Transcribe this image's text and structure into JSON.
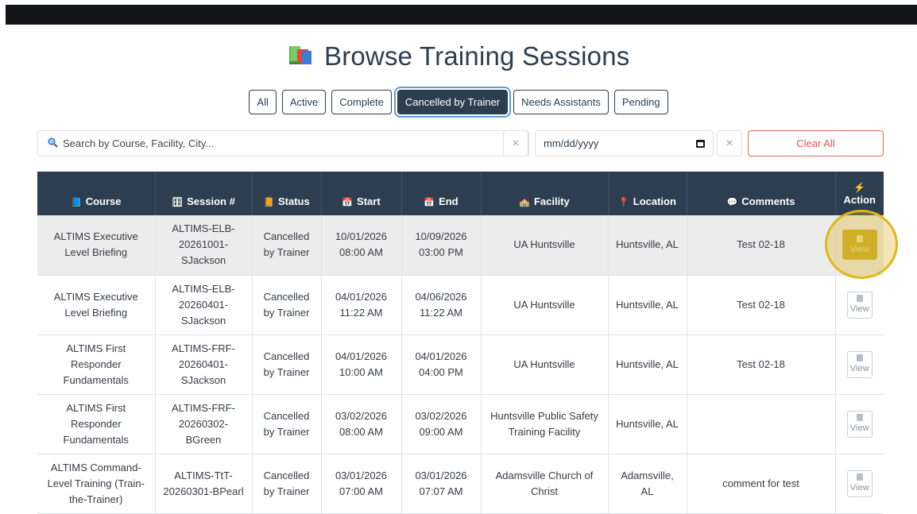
{
  "page": {
    "title": "Browse Training Sessions"
  },
  "filters": [
    {
      "label": "All",
      "active": false
    },
    {
      "label": "Active",
      "active": false
    },
    {
      "label": "Complete",
      "active": false
    },
    {
      "label": "Cancelled by Trainer",
      "active": true
    },
    {
      "label": "Needs Assistants",
      "active": false
    },
    {
      "label": "Pending",
      "active": false
    }
  ],
  "search": {
    "placeholder": "Search by Course, Facility, City...",
    "clear_glyph": "×"
  },
  "date_filter": {
    "placeholder": "mm/dd/yyyy",
    "clear_glyph": "×"
  },
  "clear_all_label": "Clear All",
  "table": {
    "headers": {
      "course": "Course",
      "session": "Session #",
      "status": "Status",
      "start": "Start",
      "end": "End",
      "facility": "Facility",
      "location": "Location",
      "comments": "Comments",
      "action": "Action"
    },
    "view_label": "View",
    "rows": [
      {
        "course": [
          "ALTIMS Executive",
          "Level Briefing"
        ],
        "session": [
          "ALTIMS-ELB-",
          "20261001-",
          "SJackson"
        ],
        "status": [
          "Cancelled",
          "by Trainer"
        ],
        "start": [
          "10/01/2026",
          "08:00 AM"
        ],
        "end": [
          "10/09/2026",
          "03:00 PM"
        ],
        "facility": [
          "UA Huntsville"
        ],
        "location": [
          "Huntsville, AL"
        ],
        "comments": "Test 02-18"
      },
      {
        "course": [
          "ALTIMS Executive",
          "Level Briefing"
        ],
        "session": [
          "ALTIMS-ELB-",
          "20260401-",
          "SJackson"
        ],
        "status": [
          "Cancelled",
          "by Trainer"
        ],
        "start": [
          "04/01/2026",
          "11:22 AM"
        ],
        "end": [
          "04/06/2026",
          "11:22 AM"
        ],
        "facility": [
          "UA Huntsville"
        ],
        "location": [
          "Huntsville, AL"
        ],
        "comments": "Test 02-18"
      },
      {
        "course": [
          "ALTIMS First",
          "Responder",
          "Fundamentals"
        ],
        "session": [
          "ALTIMS-FRF-",
          "20260401-",
          "SJackson"
        ],
        "status": [
          "Cancelled",
          "by Trainer"
        ],
        "start": [
          "04/01/2026",
          "10:00 AM"
        ],
        "end": [
          "04/01/2026",
          "04:00 PM"
        ],
        "facility": [
          "UA Huntsville"
        ],
        "location": [
          "Huntsville, AL"
        ],
        "comments": "Test 02-18"
      },
      {
        "course": [
          "ALTIMS First",
          "Responder",
          "Fundamentals"
        ],
        "session": [
          "ALTIMS-FRF-",
          "20260302-",
          "BGreen"
        ],
        "status": [
          "Cancelled",
          "by Trainer"
        ],
        "start": [
          "03/02/2026",
          "08:00 AM"
        ],
        "end": [
          "03/02/2026",
          "09:00 AM"
        ],
        "facility": [
          "Huntsville Public Safety",
          "Training Facility"
        ],
        "location": [
          "Huntsville, AL"
        ],
        "comments": ""
      },
      {
        "course": [
          "ALTIMS Command-",
          "Level Training (Train-",
          "the-Trainer)"
        ],
        "session": [
          "ALTIMS-TtT-",
          "20260301-BPearl"
        ],
        "status": [
          "Cancelled",
          "by Trainer"
        ],
        "start": [
          "03/01/2026",
          "07:00 AM"
        ],
        "end": [
          "03/01/2026",
          "07:07 AM"
        ],
        "facility": [
          "Adamsville Church of",
          "Christ"
        ],
        "location": [
          "Adamsville,",
          "AL"
        ],
        "comments": "comment for test"
      }
    ]
  },
  "colors": {
    "header_bg": "#2c3e50",
    "accent_highlight": "#e2b616",
    "clear_all": "#e05a4a"
  }
}
